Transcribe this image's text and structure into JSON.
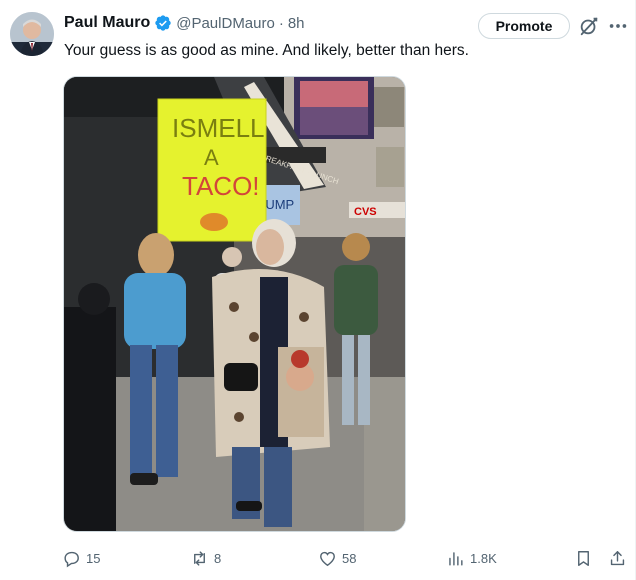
{
  "tweet": {
    "author_name": "Paul Mauro",
    "handle": "@PaulDMauro",
    "separator": "·",
    "time": "8h",
    "text": "Your guess is as good as mine. And likely, better than hers.",
    "promote_label": "Promote",
    "verified": true,
    "accent_color": "#1d9bf0",
    "media": {
      "type": "photo",
      "sign_text": [
        "ISMELL",
        "A",
        "TACO!"
      ],
      "secondary_sign_text": "TRUMP",
      "storefront_text": "BREAKFAST · LUNCH",
      "store_sign_text": "CVS"
    }
  },
  "actions": {
    "replies": "15",
    "retweets": "8",
    "likes": "58",
    "views": "1.8K"
  },
  "icons": {
    "avatar": "avatar",
    "verified": "verified-badge-icon",
    "grok": "grok-icon",
    "more": "more-icon",
    "reply": "reply-icon",
    "retweet": "retweet-icon",
    "like": "heart-icon",
    "views": "analytics-icon",
    "bookmark": "bookmark-icon",
    "share": "share-icon"
  }
}
